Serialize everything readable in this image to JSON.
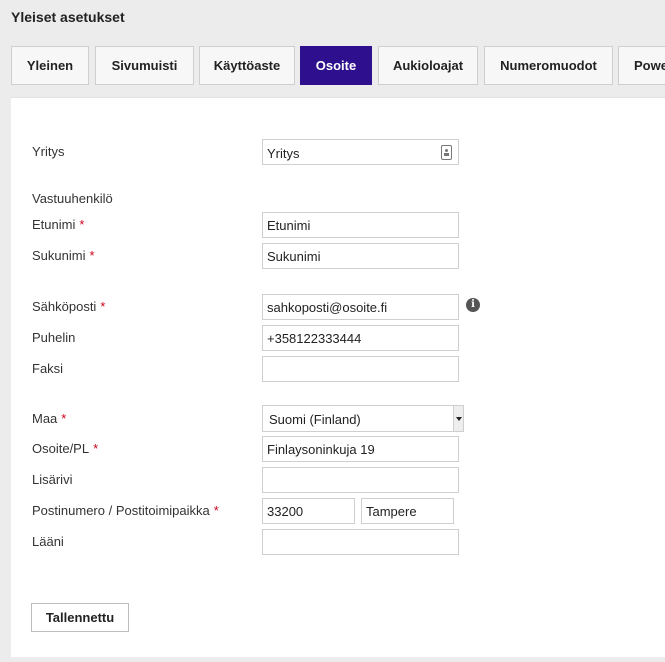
{
  "page_title": "Yleiset asetukset",
  "tabs": [
    {
      "label": "Yleinen"
    },
    {
      "label": "Sivumuisti"
    },
    {
      "label": "Käyttöaste"
    },
    {
      "label": "Osoite"
    },
    {
      "label": "Aukioloajat"
    },
    {
      "label": "Numeromuodot"
    },
    {
      "label": "Power"
    }
  ],
  "active_tab": "Osoite",
  "form": {
    "company": {
      "label": "Yritys",
      "value": "Yritys"
    },
    "contact_heading": "Vastuuhenkilö",
    "first_name": {
      "label": "Etunimi",
      "value": "Etunimi"
    },
    "last_name": {
      "label": "Sukunimi",
      "value": "Sukunimi"
    },
    "email": {
      "label": "Sähköposti",
      "value": "sahkoposti@osoite.fi"
    },
    "phone": {
      "label": "Puhelin",
      "value": "+358122333444"
    },
    "fax": {
      "label": "Faksi",
      "value": ""
    },
    "country": {
      "label": "Maa",
      "selected": "Suomi (Finland)"
    },
    "address": {
      "label": "Osoite/PL",
      "value": "Finlaysoninkuja 19"
    },
    "extra_line": {
      "label": "Lisärivi",
      "value": ""
    },
    "postal": {
      "label": "Postinumero / Postitoimipaikka",
      "code": "33200",
      "city": "Tampere"
    },
    "province": {
      "label": "Lääni",
      "value": ""
    },
    "required_marker": "*"
  },
  "save_label": "Tallennettu",
  "icons": {
    "company_field": "contact-card-icon",
    "email_info": "info-icon"
  },
  "colors": {
    "active_tab": "#2e0f8e",
    "required": "#d0021b"
  }
}
